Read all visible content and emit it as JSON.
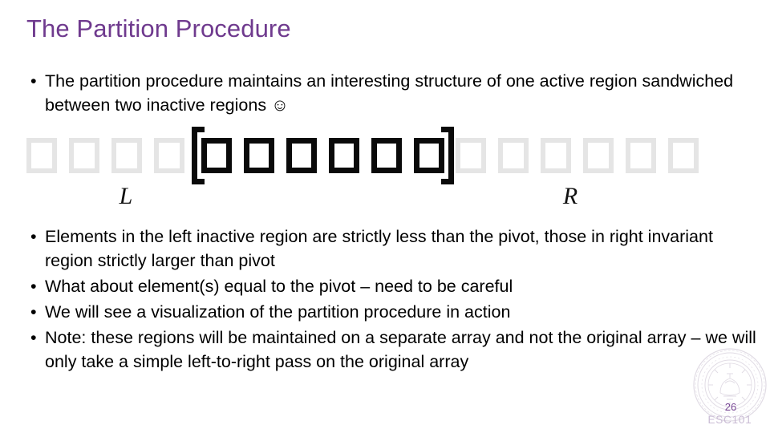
{
  "slide": {
    "title": "The Partition Procedure",
    "title_color": "#6F3A8E"
  },
  "bullets_top": [
    {
      "marker": "•",
      "text": "The partition procedure maintains an interesting structure of one active region sandwiched between two inactive regions ☺"
    }
  ],
  "bullets_bottom": [
    {
      "marker": "•",
      "text": "Elements in the left inactive region are strictly less than the pivot, those in right invariant region strictly larger than pivot"
    },
    {
      "marker": "•",
      "text": "What about element(s) equal to the pivot – need to be careful"
    },
    {
      "marker": "•",
      "text": "We will see a visualization of the partition procedure in action"
    },
    {
      "marker": "•",
      "text": "Note: these regions will be maintained on a separate array and not the original array – we will only take a simple left-to-right pass on the original array"
    }
  ],
  "array_diagram": {
    "left_inactive_count": 4,
    "active_count": 6,
    "right_inactive_count": 6,
    "inactive_color": "#E5E5E5",
    "active_color": "#0A0A0A",
    "left_label": "L",
    "right_label": "R",
    "open_bracket": "[",
    "close_bracket": "]"
  },
  "footer": {
    "page_number": "26",
    "course_code": "ESC101",
    "page_number_color": "#7A4A96"
  }
}
